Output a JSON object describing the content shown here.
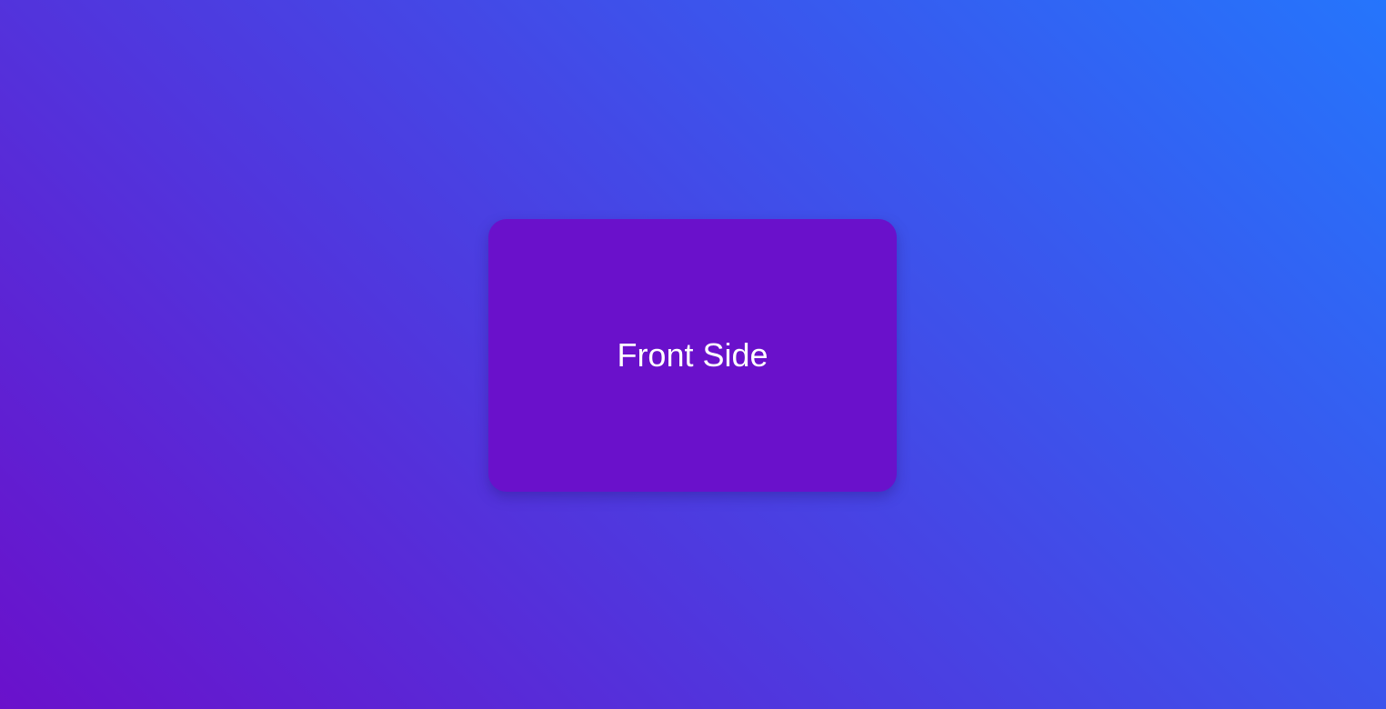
{
  "flip_card": {
    "front_label": "Front Side"
  },
  "colors": {
    "background_gradient_start": "#6a11cb",
    "background_gradient_end": "#2575fc",
    "card_background": "#6a11cb",
    "card_text": "#ffffff"
  }
}
